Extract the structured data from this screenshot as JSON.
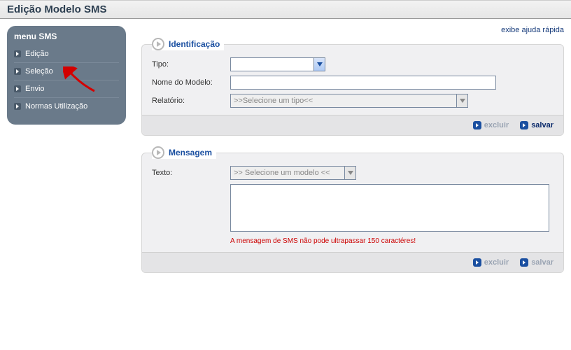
{
  "page_title": "Edição Modelo SMS",
  "help_link": "exibe ajuda rápida",
  "sidebar": {
    "title": "menu SMS",
    "items": [
      {
        "label": "Edição"
      },
      {
        "label": "Seleção"
      },
      {
        "label": "Envio"
      },
      {
        "label": "Normas Utilização"
      }
    ]
  },
  "identificacao": {
    "legend": "Identificação",
    "tipo_label": "Tipo:",
    "tipo_value": "",
    "nome_label": "Nome do Modelo:",
    "nome_value": "",
    "relatorio_label": "Relatório:",
    "relatorio_placeholder": ">>Selecione um tipo<<",
    "excluir_label": "excluir",
    "salvar_label": "salvar"
  },
  "mensagem": {
    "legend": "Mensagem",
    "texto_label": "Texto:",
    "modelo_placeholder": ">> Selecione um modelo <<",
    "texto_value": "",
    "hint": "A mensagem de SMS não pode ultrapassar 150 caractéres!",
    "excluir_label": "excluir",
    "salvar_label": "salvar"
  }
}
